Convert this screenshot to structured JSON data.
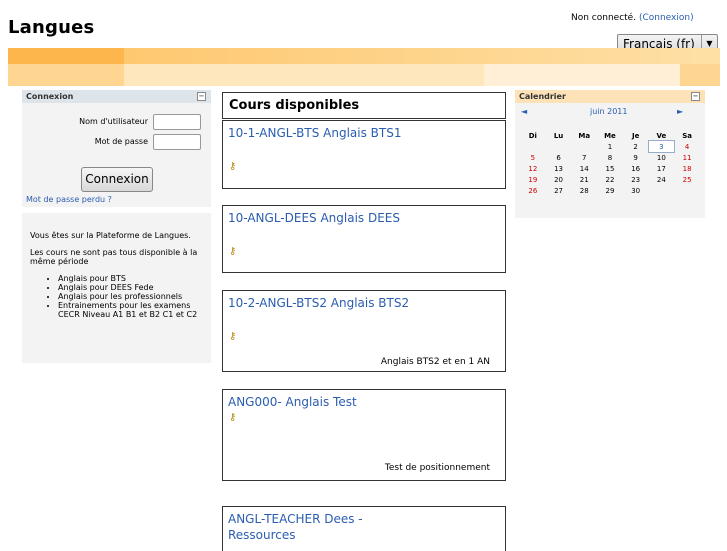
{
  "site": {
    "title": "Langues"
  },
  "login_info": {
    "text": "Non connecté.",
    "link": "(Connexion)"
  },
  "language_select": {
    "value": "Français (fr)"
  },
  "login_block": {
    "title": "Connexion",
    "username_label": "Nom d'utilisateur",
    "password_label": "Mot de passe",
    "username_value": "",
    "password_value": "",
    "submit_label": "Connexion",
    "forgot_link": "Mot de passe perdu ?"
  },
  "info_block": {
    "intro": "Vous êtes sur la Plateforme de Langues.",
    "note": "Les cours ne sont pas tous disponible à la même période",
    "items": [
      "Anglais pour BTS",
      "Anglais pour DEES Fede",
      "Anglais pour les professionnels",
      "Entrainements pour les examens CECR Niveau A1 B1 et B2 C1 et C2"
    ]
  },
  "courses": {
    "title": "Cours disponibles",
    "list": [
      {
        "name": "10-1-ANGL-BTS Anglais BTS1",
        "summary": ""
      },
      {
        "name": "10-ANGL-DEES Anglais DEES",
        "summary": ""
      },
      {
        "name": "10-2-ANGL-BTS2 Anglais BTS2",
        "summary": "Anglais BTS2 et en 1 AN"
      },
      {
        "name": "ANG000- Anglais Test",
        "summary": "Test de positionnement"
      },
      {
        "name": "ANGL-TEACHER Dees - Ressources",
        "summary": ""
      }
    ],
    "guest_icon": "key-icon"
  },
  "calendar": {
    "title": "Calendrier",
    "month": "juin 2011",
    "prev": "◄",
    "next": "►",
    "days": [
      "Di",
      "Lu",
      "Ma",
      "Me",
      "Je",
      "Ve",
      "Sa"
    ],
    "weeks": [
      [
        "",
        "",
        "",
        "1",
        "2",
        "3",
        "4"
      ],
      [
        "5",
        "6",
        "7",
        "8",
        "9",
        "10",
        "11"
      ],
      [
        "12",
        "13",
        "14",
        "15",
        "16",
        "17",
        "18"
      ],
      [
        "19",
        "20",
        "21",
        "22",
        "23",
        "24",
        "25"
      ],
      [
        "26",
        "27",
        "28",
        "29",
        "30",
        "",
        ""
      ]
    ],
    "today": "3",
    "weekend_color": "#cc0000"
  }
}
